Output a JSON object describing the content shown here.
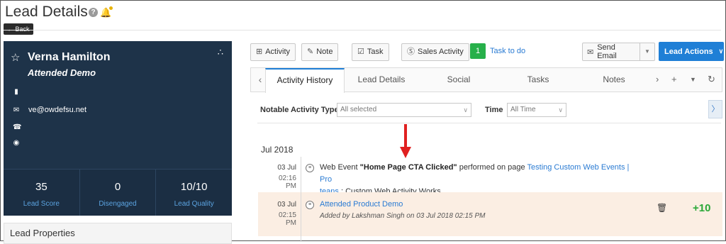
{
  "header": {
    "title": "Lead Details",
    "help_icon": "?",
    "back_label": "Back"
  },
  "lead": {
    "name": "Verna Hamilton",
    "stage": "Attended Demo",
    "email": "ve@owdefsu.net",
    "stats": [
      {
        "value": "35",
        "label": "Lead Score"
      },
      {
        "value": "0",
        "label": "Disengaged"
      },
      {
        "value": "10/10",
        "label": "Lead Quality"
      }
    ]
  },
  "lead_properties_label": "Lead Properties",
  "toolbar": {
    "activity": "Activity",
    "note": "Note",
    "task": "Task",
    "sales_activity": "Sales Activity",
    "todo_count": "1",
    "todo_label": "Task to do",
    "send_email": "Send Email",
    "lead_actions": "Lead Actions"
  },
  "tabs": [
    {
      "label": "Activity History"
    },
    {
      "label": "Lead Details"
    },
    {
      "label": "Social"
    },
    {
      "label": "Tasks"
    },
    {
      "label": "Notes"
    }
  ],
  "filters": {
    "notable_label": "Notable Activity Type",
    "notable_value": "All selected",
    "time_label": "Time",
    "time_value": "All Time"
  },
  "timeline": {
    "month": "Jul 2018",
    "entries": [
      {
        "date": "03 Jul",
        "time": "02:16 PM",
        "prefix": "Web Event ",
        "event_name": "\"Home Page CTA Clicked\"",
        "middle": " performed on page ",
        "page_link_1": "Testing Custom Web Events | Pro",
        "page_link_2": "teans",
        "suffix": " : Custom Web Activity Works."
      },
      {
        "date": "03 Jul",
        "time": "02:15 PM",
        "title": "Attended Product Demo",
        "added_by": "Added by Lakshman Singh on 03 Jul 2018 02:15 PM",
        "score": "+10"
      }
    ]
  },
  "colors": {
    "card_bg": "#1e3349",
    "accent_blue": "#1f7fd6",
    "todo_green": "#27b04a",
    "score_green": "#2aa838",
    "highlight_bg": "#fbeee3",
    "arrow_red": "#e02020"
  }
}
